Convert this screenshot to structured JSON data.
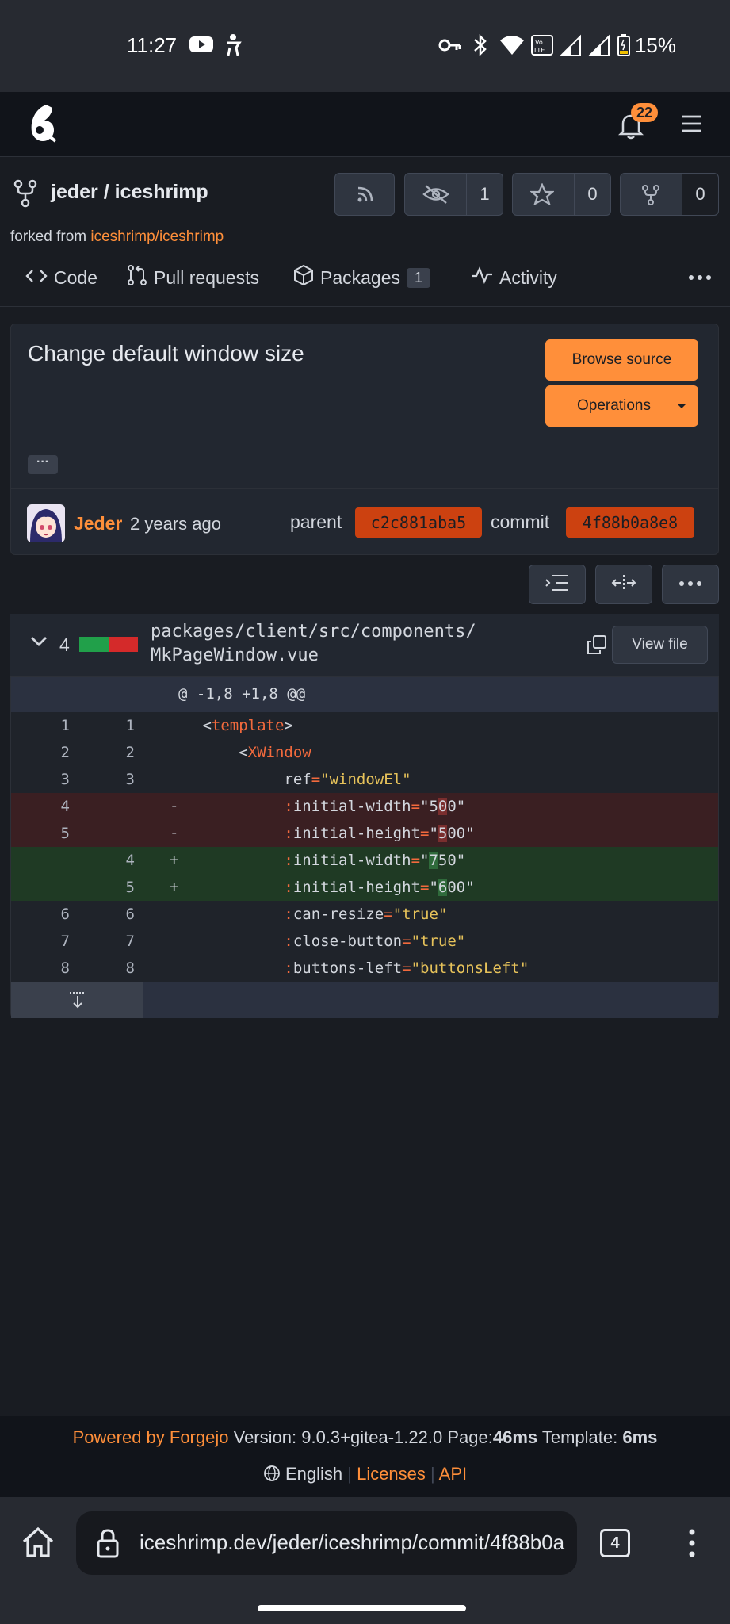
{
  "status_bar": {
    "time": "11:27",
    "battery": "15%"
  },
  "navbar": {
    "notifications_count": "22"
  },
  "repo": {
    "title": "jeder / iceshrimp",
    "forked_prefix": "forked from",
    "forked_link": "iceshrimp/iceshrimp",
    "watch_count": "1",
    "star_count": "0",
    "fork_count": "0"
  },
  "tabs": [
    {
      "label": "Code"
    },
    {
      "label": "Pull requests"
    },
    {
      "label": "Packages",
      "badge": "1"
    },
    {
      "label": "Activity"
    }
  ],
  "commit": {
    "title": "Change default window size",
    "browse_source": "Browse source",
    "operations": "Operations",
    "ellipsis": "···",
    "author": "Jeder",
    "time": "2 years ago",
    "parent_label": "parent",
    "parent_sha": "c2c881aba5",
    "commit_label": "commit",
    "commit_sha": "4f88b0a8e8"
  },
  "diff": {
    "changes": "4",
    "file_path_line1": "packages/client/src/components/",
    "file_path_line2": "MkPageWindow.vue",
    "view_file": "View file",
    "hunk_header": "@ -1,8 +1,8 @@",
    "lines": [
      {
        "old": "1",
        "new": "1",
        "sign": "",
        "type": "ctx"
      },
      {
        "old": "2",
        "new": "2",
        "sign": "",
        "type": "ctx"
      },
      {
        "old": "3",
        "new": "3",
        "sign": "",
        "type": "ctx"
      },
      {
        "old": "4",
        "new": "",
        "sign": "-",
        "type": "del"
      },
      {
        "old": "5",
        "new": "",
        "sign": "-",
        "type": "del"
      },
      {
        "old": "",
        "new": "4",
        "sign": "+",
        "type": "add"
      },
      {
        "old": "",
        "new": "5",
        "sign": "+",
        "type": "add"
      },
      {
        "old": "6",
        "new": "6",
        "sign": "",
        "type": "ctx"
      },
      {
        "old": "7",
        "new": "7",
        "sign": "",
        "type": "ctx"
      },
      {
        "old": "8",
        "new": "8",
        "sign": "",
        "type": "ctx"
      }
    ]
  },
  "footer": {
    "powered": "Powered by Forgejo",
    "version_label": "Version:",
    "version": "9.0.3+gitea-1.22.0",
    "page_label": "Page:",
    "page_time": "46ms",
    "template_label": "Template:",
    "template_time": "6ms",
    "language": "English",
    "licenses": "Licenses",
    "api": "API"
  },
  "browser": {
    "url": "iceshrimp.dev/jeder/iceshrimp/commit/4f88b0a",
    "tab_count": "4"
  }
}
